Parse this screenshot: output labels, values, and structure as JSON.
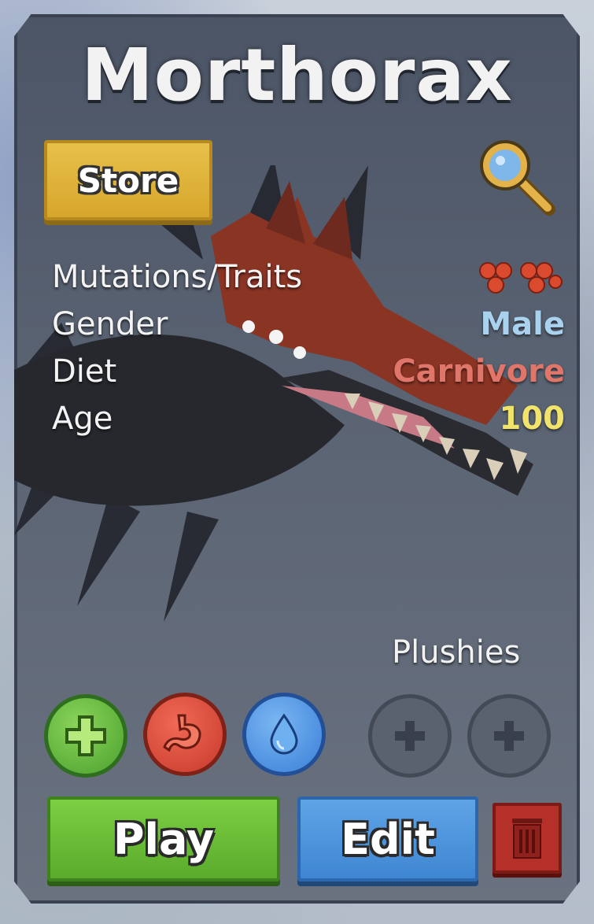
{
  "title": "Morthorax",
  "store_label": "Store",
  "stats": [
    {
      "label": "Mutations/Traits",
      "value": ""
    },
    {
      "label": "Gender",
      "value": "Male"
    },
    {
      "label": "Diet",
      "value": "Carnivore"
    },
    {
      "label": "Age",
      "value": "100"
    }
  ],
  "plushies_label": "Plushies",
  "actions": {
    "play_label": "Play",
    "edit_label": "Edit"
  },
  "icons": {
    "search": "magnifier-icon",
    "mutation": "mutation-icon",
    "health": "plus-icon",
    "food": "stomach-icon",
    "water": "water-drop-icon",
    "plush_add": "plus-icon",
    "delete": "trash-icon"
  },
  "colors": {
    "gender": "#a9d2ef",
    "diet": "#e0756a",
    "age": "#f2e46a",
    "play": "#6abf35",
    "edit": "#4b92dc",
    "store": "#e1b63f",
    "delete": "#b6302a"
  }
}
